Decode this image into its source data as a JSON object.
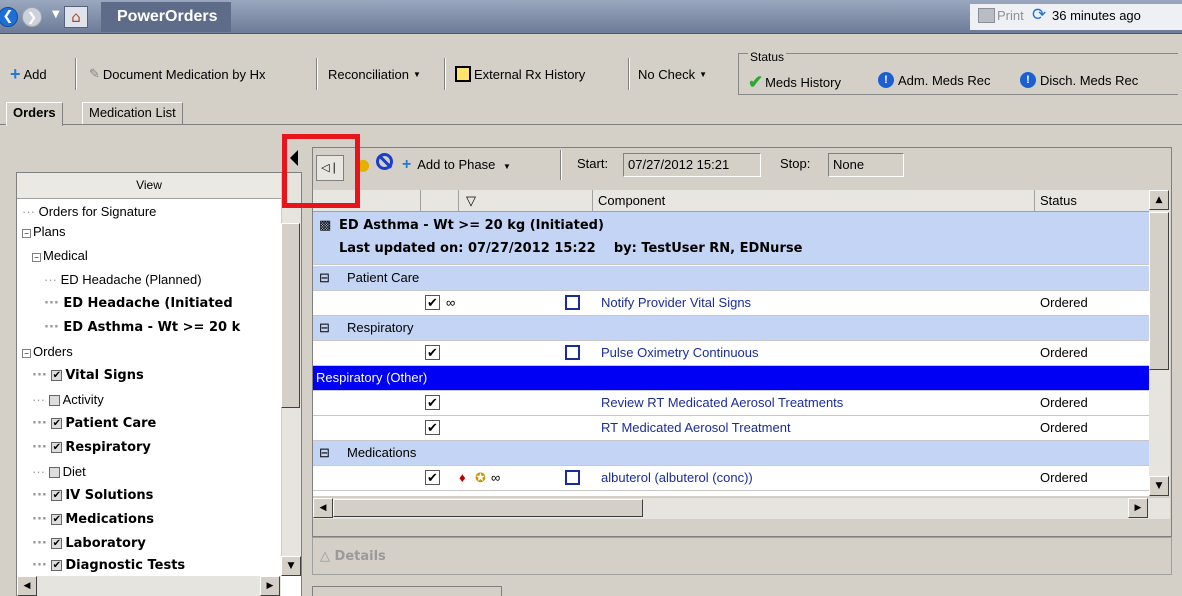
{
  "titlebar": {
    "title": "PowerOrders",
    "print_label": "Print",
    "refresh_text": "36 minutes ago",
    "back_icon": "back-arrow-icon",
    "home_icon": "home-icon"
  },
  "toolbar": {
    "add_label": "Add",
    "document_med_label": "Document Medication by Hx",
    "reconciliation_label": "Reconciliation",
    "external_rx_label": "External Rx History",
    "no_check_label": "No Check"
  },
  "status": {
    "legend": "Status",
    "meds_history": "Meds History",
    "adm_meds_rec": "Adm. Meds Rec",
    "disch_meds_rec": "Disch. Meds Rec"
  },
  "tabs": [
    {
      "label": "Orders",
      "active": true
    },
    {
      "label": "Medication List",
      "active": false
    }
  ],
  "view": {
    "header": "View",
    "items": [
      {
        "label": "Orders for Signature",
        "bold": false
      },
      {
        "label": "Plans",
        "bold": false
      },
      {
        "label": "Medical",
        "bold": false
      },
      {
        "label": "ED Headache (Planned)",
        "bold": false
      },
      {
        "label": "ED Headache (Initiated",
        "bold": true
      },
      {
        "label": "ED Asthma - Wt >= 20 k",
        "bold": true
      },
      {
        "label": "Orders",
        "bold": false
      },
      {
        "label": "Vital Signs",
        "bold": true
      },
      {
        "label": "Activity",
        "bold": false
      },
      {
        "label": "Patient Care",
        "bold": true
      },
      {
        "label": "Respiratory",
        "bold": true
      },
      {
        "label": "Diet",
        "bold": false
      },
      {
        "label": "IV Solutions",
        "bold": true
      },
      {
        "label": "Medications",
        "bold": true
      },
      {
        "label": "Laboratory",
        "bold": true
      },
      {
        "label": "Diagnostic Tests",
        "bold": true
      }
    ]
  },
  "phase_toolbar": {
    "add_to_phase": "Add to Phase",
    "start_label": "Start:",
    "start_value": "07/27/2012 15:21",
    "stop_label": "Stop:",
    "stop_value": "None"
  },
  "grid": {
    "columns": [
      "Component",
      "Status"
    ],
    "plan_title": "ED Asthma - Wt >= 20 kg (Initiated)",
    "plan_updated": "Last updated on: 07/27/2012 15:22    by: TestUser RN, EDNurse",
    "rows": [
      {
        "type": "category",
        "label": "Patient Care"
      },
      {
        "type": "order",
        "component": "Notify Provider Vital Signs",
        "status": "Ordered"
      },
      {
        "type": "category",
        "label": "Respiratory"
      },
      {
        "type": "order",
        "component": "Pulse Oximetry Continuous",
        "status": "Ordered"
      },
      {
        "type": "category-selected",
        "label": "Respiratory (Other)"
      },
      {
        "type": "order",
        "component": "Review RT Medicated Aerosol Treatments",
        "status": "Ordered"
      },
      {
        "type": "order",
        "component": "RT Medicated Aerosol Treatment",
        "status": "Ordered"
      },
      {
        "type": "category",
        "label": "Medications"
      },
      {
        "type": "order",
        "component": "albuterol (albuterol (conc))",
        "status": "Ordered"
      }
    ]
  },
  "details": {
    "label": "Details"
  },
  "colors": {
    "category_bg": "#c4d4f4",
    "selected_bg": "#0000f5",
    "highlight_box": "#e8141b"
  }
}
